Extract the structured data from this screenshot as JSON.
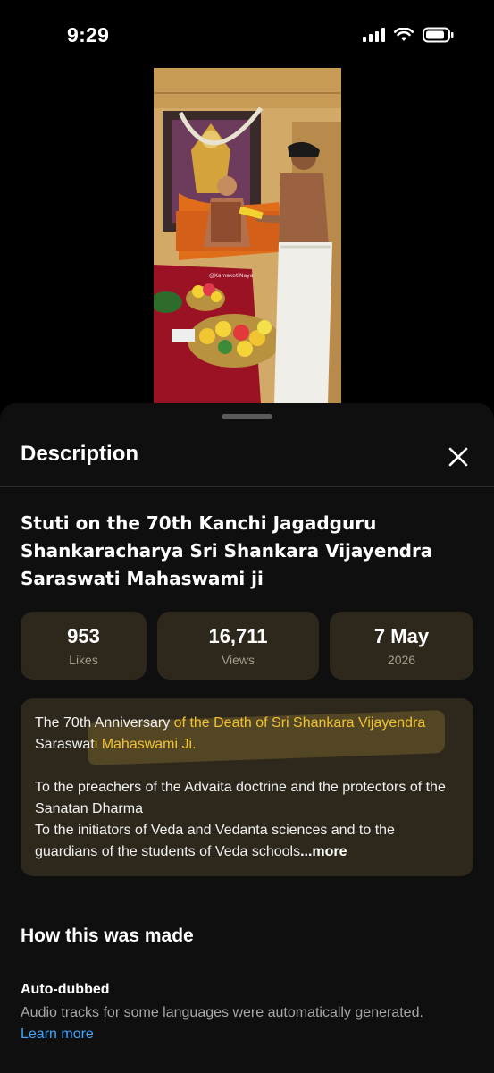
{
  "status_bar": {
    "time": "9:29"
  },
  "video": {
    "watermark": "@KamakotiNaya"
  },
  "sheet": {
    "title": "Description",
    "video_title": "Stuti on the 70th Kanchi Jagadguru Shankaracharya Sri Shankara Vijayendra Saraswati Mahaswami ji",
    "stats": [
      {
        "value": "953",
        "label": "Likes"
      },
      {
        "value": "16,711",
        "label": "Views"
      },
      {
        "value": "7 May",
        "label": "2026"
      }
    ],
    "description": {
      "p1_a": "The 70th Anniversary",
      "p1_b": " of the Death of Sri Shankara Vijayendra",
      "p1_c": "Saraswat",
      "p1_d": "i Mahaswami Ji.",
      "p2": "To the preachers of the Advaita doctrine and the protectors of the Sanatan Dharma",
      "p3": "To the initiators of Veda and Vedanta sciences and to the guardians of the students of Veda schools",
      "more": "...more"
    },
    "made_section": {
      "title": "How this was made",
      "autodub_title": "Auto-dubbed",
      "autodub_desc": "Audio tracks for some languages were automatically generated.",
      "learn_more": "Learn more"
    }
  },
  "colors": {
    "accent_link": "#3ea6ff",
    "highlight": "#f1c232",
    "card_bg": "#2e281c"
  }
}
